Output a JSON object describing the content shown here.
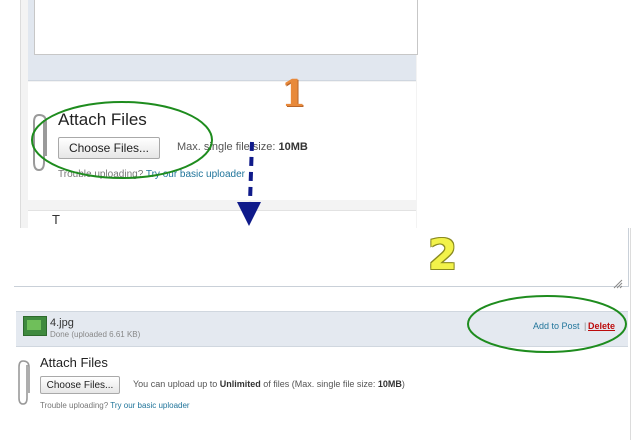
{
  "step_one": {
    "marker": "1",
    "attach_heading": "Attach Files",
    "choose_button": "Choose Files...",
    "max_size_prefix": "Max. single file size:",
    "max_size_value": "10MB",
    "trouble_text": "Trouble uploading?",
    "basic_uploader_link": "Try our basic uploader",
    "partial_text": "T"
  },
  "step_two": {
    "marker": "2",
    "file": {
      "name": "4.jpg",
      "status": "Done (uploaded 6.61 KB)",
      "add_to_post": "Add to Post",
      "separator": "|",
      "delete": "Delete"
    },
    "attach_heading": "Attach Files",
    "choose_button": "Choose Files...",
    "upload_info_prefix": "You can upload up to",
    "upload_info_unlimited": "Unlimited",
    "upload_info_middle": "of files (Max. single file size:",
    "upload_info_size": "10MB",
    "upload_info_suffix": ")",
    "trouble_text": "Trouble uploading?",
    "basic_uploader_link": "Try our basic uploader"
  },
  "colors": {
    "annotation_ellipse": "#1e8c1e",
    "arrow": "#0f1a8a",
    "link": "#21759b",
    "delete": "#bc0b0b",
    "step1_marker": "#e8893a",
    "step2_marker": "#f2f24a"
  },
  "icons": [
    "paperclip-icon",
    "image-thumbnail-icon",
    "resize-handle-icon",
    "dashed-down-arrow-icon"
  ]
}
